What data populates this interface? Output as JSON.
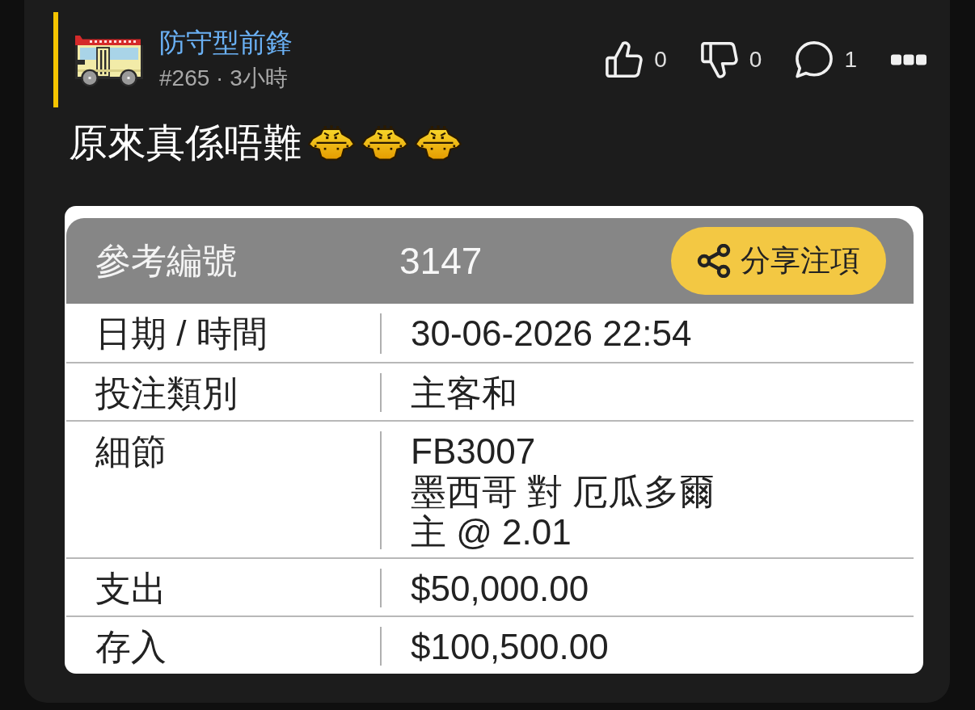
{
  "post": {
    "highlighted": true,
    "author": "防守型前鋒",
    "meta": "#265 · 3小時",
    "actions": [
      {
        "kind": "like",
        "count": "0"
      },
      {
        "kind": "dislike",
        "count": "0"
      },
      {
        "kind": "comment",
        "count": "1"
      },
      {
        "kind": "more"
      }
    ],
    "text": "原來真係唔難",
    "stickers": [
      {
        "kind": "face"
      },
      {
        "kind": "face"
      },
      {
        "kind": "face"
      }
    ],
    "attachment": {
      "header": {
        "label": "參考編號",
        "value": "3147",
        "button": "分享注項"
      },
      "rows": [
        {
          "label": "日期 / 時間",
          "lines": [
            "30-06-2026 22:54"
          ]
        },
        {
          "label": "投注類別",
          "lines": [
            "主客和"
          ]
        },
        {
          "label": "細節",
          "lines": [
            "FB3007",
            "墨西哥 對 厄瓜多爾",
            "主 @ 2.01"
          ]
        },
        {
          "label": "支出",
          "lines": [
            "$50,000.00"
          ]
        },
        {
          "label": "存入",
          "lines": [
            "$100,500.00"
          ]
        }
      ]
    }
  }
}
